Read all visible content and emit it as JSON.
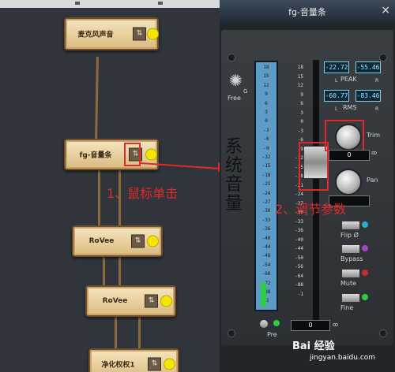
{
  "plugin": {
    "title": "fg-音量条",
    "close": "×",
    "logo": "Free",
    "logo_mark": "G",
    "peak_left": "-22.72",
    "peak_right": "-55.46",
    "peak_label": "PEAK",
    "rms_left": "-60.77",
    "rms_right": "-83.46",
    "rms_label": "RMS",
    "l_label": "L",
    "r_label": "R",
    "trim_label": "Trim",
    "trim_value": "0",
    "pan_label": "Pan",
    "flip_label": "Flip Ø",
    "bypass_label": "Bypass",
    "mute_label": "Mute",
    "fine_label": "Fine",
    "pre_label": "Pre",
    "fader_value": "0",
    "meter_scale": [
      "18",
      "15",
      "12",
      "9",
      "6",
      "3",
      "0",
      "-3",
      "-6",
      "-9",
      "-12",
      "-15",
      "-18",
      "-21",
      "-24",
      "-27",
      "-30",
      "-33",
      "-36",
      "-40",
      "-44",
      "-48",
      "-54",
      "-60",
      "-72",
      "-88",
      "-1"
    ],
    "fader_scale": [
      "18",
      "15",
      "12",
      "9",
      "6",
      "3",
      "0",
      "-3",
      "-6",
      "-9",
      "-12",
      "-15",
      "-18",
      "-21",
      "-24",
      "-27",
      "-30",
      "-33",
      "-36",
      "-40",
      "-44",
      "-50",
      "-56",
      "-64",
      "-88",
      "-1"
    ]
  },
  "graph": {
    "nodes": [
      {
        "name": "麦克风声音",
        "icon": "⇅"
      },
      {
        "name": "fg-音量条",
        "icon": "⇅"
      },
      {
        "name": "RoVee",
        "icon": "⇅"
      },
      {
        "name": "RoVee",
        "icon": "⇅"
      },
      {
        "name": "净化权权1",
        "icon": "⇅"
      }
    ]
  },
  "annotations": {
    "step1": "1、鼠标单击",
    "step2": "2、调节参数",
    "vertical": "系统音量"
  },
  "watermark": {
    "brand": "Bai 经验",
    "url": "jingyan.baidu.com"
  }
}
